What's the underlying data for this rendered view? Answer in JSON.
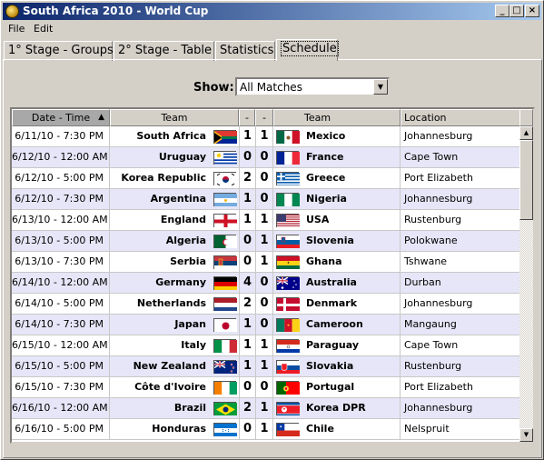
{
  "window": {
    "title": "South Africa 2010 - World Cup",
    "minimize_icon": "minimize-icon",
    "maximize_icon": "maximize-icon",
    "close_icon": "close-icon"
  },
  "menu": [
    "File",
    "Edit"
  ],
  "tabs": [
    {
      "label": "1° Stage - Groups",
      "active": false
    },
    {
      "label": "2° Stage - Table",
      "active": false
    },
    {
      "label": "Statistics",
      "active": false
    },
    {
      "label": "Schedule",
      "active": true
    }
  ],
  "filter": {
    "label": "Show:",
    "value": "All Matches"
  },
  "table": {
    "headers": [
      "Date - Time",
      "Team",
      "-",
      "-",
      "Team",
      "Location"
    ],
    "sorted_column": "Date - Time",
    "rows": [
      {
        "date": "6/11/10 - 7:30 PM",
        "home": "South Africa",
        "hf": "rsa",
        "hs": "1",
        "as": "1",
        "af": "mex",
        "away": "Mexico",
        "loc": "Johannesburg"
      },
      {
        "date": "6/12/10 - 12:00 AM",
        "home": "Uruguay",
        "hf": "uru",
        "hs": "0",
        "as": "0",
        "af": "fra",
        "away": "France",
        "loc": "Cape Town"
      },
      {
        "date": "6/12/10 - 5:00 PM",
        "home": "Korea Republic",
        "hf": "kor",
        "hs": "2",
        "as": "0",
        "af": "gre",
        "away": "Greece",
        "loc": "Port Elizabeth"
      },
      {
        "date": "6/12/10 - 7:30 PM",
        "home": "Argentina",
        "hf": "arg",
        "hs": "1",
        "as": "0",
        "af": "nga",
        "away": "Nigeria",
        "loc": "Johannesburg"
      },
      {
        "date": "6/13/10 - 12:00 AM",
        "home": "England",
        "hf": "eng",
        "hs": "1",
        "as": "1",
        "af": "usa",
        "away": "USA",
        "loc": "Rustenburg"
      },
      {
        "date": "6/13/10 - 5:00 PM",
        "home": "Algeria",
        "hf": "alg",
        "hs": "0",
        "as": "1",
        "af": "svn",
        "away": "Slovenia",
        "loc": "Polokwane"
      },
      {
        "date": "6/13/10 - 7:30 PM",
        "home": "Serbia",
        "hf": "srb",
        "hs": "0",
        "as": "1",
        "af": "gha",
        "away": "Ghana",
        "loc": "Tshwane"
      },
      {
        "date": "6/14/10 - 12:00 AM",
        "home": "Germany",
        "hf": "ger",
        "hs": "4",
        "as": "0",
        "af": "aus",
        "away": "Australia",
        "loc": "Durban"
      },
      {
        "date": "6/14/10 - 5:00 PM",
        "home": "Netherlands",
        "hf": "ned",
        "hs": "2",
        "as": "0",
        "af": "den",
        "away": "Denmark",
        "loc": "Johannesburg"
      },
      {
        "date": "6/14/10 - 7:30 PM",
        "home": "Japan",
        "hf": "jpn",
        "hs": "1",
        "as": "0",
        "af": "cmr",
        "away": "Cameroon",
        "loc": "Mangaung"
      },
      {
        "date": "6/15/10 - 12:00 AM",
        "home": "Italy",
        "hf": "ita",
        "hs": "1",
        "as": "1",
        "af": "par",
        "away": "Paraguay",
        "loc": "Cape Town"
      },
      {
        "date": "6/15/10 - 5:00 PM",
        "home": "New Zealand",
        "hf": "nzl",
        "hs": "1",
        "as": "1",
        "af": "svk",
        "away": "Slovakia",
        "loc": "Rustenburg"
      },
      {
        "date": "6/15/10 - 7:30 PM",
        "home": "Côte d'Ivoire",
        "hf": "civ",
        "hs": "0",
        "as": "0",
        "af": "por",
        "away": "Portugal",
        "loc": "Port Elizabeth"
      },
      {
        "date": "6/16/10 - 12:00 AM",
        "home": "Brazil",
        "hf": "bra",
        "hs": "2",
        "as": "1",
        "af": "prk",
        "away": "Korea DPR",
        "loc": "Johannesburg"
      },
      {
        "date": "6/16/10 - 5:00 PM",
        "home": "Honduras",
        "hf": "hon",
        "hs": "0",
        "as": "1",
        "af": "chi",
        "away": "Chile",
        "loc": "Nelspruit"
      }
    ]
  }
}
